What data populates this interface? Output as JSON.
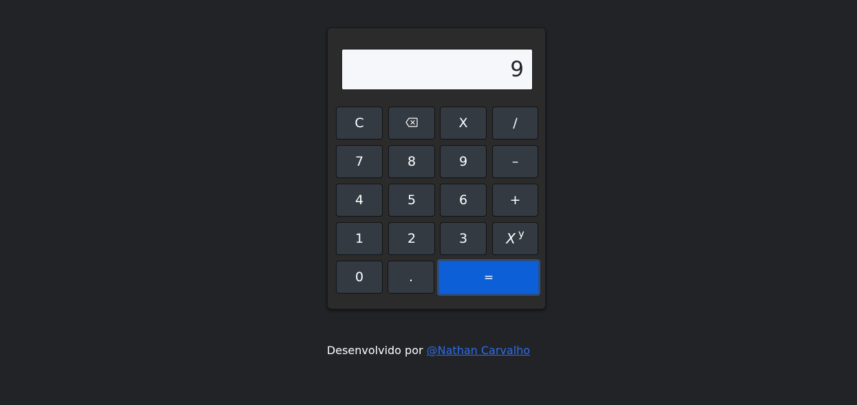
{
  "display": {
    "value": "9"
  },
  "buttons": {
    "clear": "C",
    "backspace_icon": "backspace-icon",
    "multiply": "X",
    "divide": "/",
    "seven": "7",
    "eight": "8",
    "nine": "9",
    "subtract": "–",
    "four": "4",
    "five": "5",
    "six": "6",
    "add": "+",
    "one": "1",
    "two": "2",
    "three": "3",
    "power_base": "X",
    "power_exp": "y",
    "zero": "0",
    "decimal": ".",
    "equals": "="
  },
  "footer": {
    "prefix": "Desenvolvido por",
    "link": "@Nathan Carvalho"
  },
  "colors": {
    "background": "#212327",
    "calculator_body": "#2b2b2b",
    "button": "#343a42",
    "equals_button": "#0c5fd6",
    "link": "#2f6de8"
  }
}
